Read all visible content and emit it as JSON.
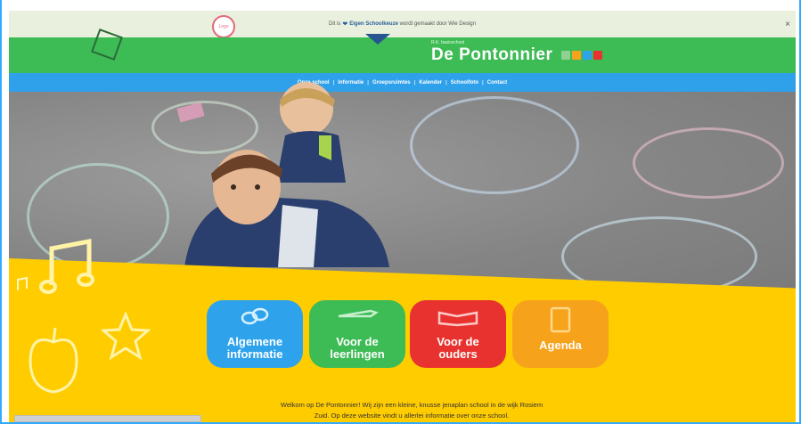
{
  "topbar": {
    "prefix": "Dit is",
    "heart_icon": "heart-icon",
    "link": "Eigen Schoolkeuze",
    "suffix": "wordt gemaakt door Wie Design",
    "close": "×",
    "logo": "Logo"
  },
  "header": {
    "subtitle": "R.K. basisschool",
    "title": "De Pontonnier",
    "icon_colors": [
      "#3dbb55",
      "#f7a21b",
      "#2ea3ec",
      "#e8322f"
    ]
  },
  "nav": {
    "items": [
      "Onze school",
      "Informatie",
      "Groepsruimtes",
      "Kalender",
      "Schoolfoto",
      "Contact"
    ]
  },
  "tiles": [
    {
      "line1": "Algemene",
      "line2": "informatie",
      "color": "#2ea3ec",
      "icon": "chain-icon"
    },
    {
      "line1": "Voor de",
      "line2": "leerlingen",
      "color": "#3dbb55",
      "icon": "pencil-icon"
    },
    {
      "line1": "Voor de",
      "line2": "ouders",
      "color": "#e8322f",
      "icon": "book-icon"
    },
    {
      "line1": "Agenda",
      "line2": "",
      "color": "#f7a21b",
      "icon": "agenda-book-icon"
    }
  ],
  "welcome": {
    "line1": "Welkom op De Pontonnier! Wij zijn een kleine, knusse jenaplan school in de wijk Rosiem",
    "line2": "Zuid. Op deze website vindt u allerlei informatie over onze school."
  }
}
